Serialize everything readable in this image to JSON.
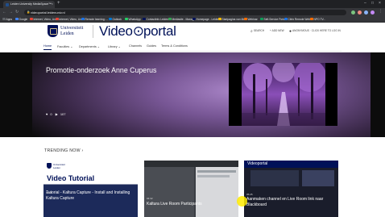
{
  "browser": {
    "tab_title": "Leiden University MediaSpace™",
    "url": "videoportal.leidenuniv.nl",
    "bookmarks": [
      {
        "label": "Apps",
        "color": "#5f6368"
      },
      {
        "label": "Google",
        "color": "#4285f4"
      },
      {
        "label": "Internet, Video, Live...",
        "color": "#ea4335"
      },
      {
        "label": "Internet, Video, Live...",
        "color": "#ea4335"
      },
      {
        "label": "Remote learning: ...",
        "color": "#1a73e8"
      },
      {
        "label": "Outlook",
        "color": "#0078d4"
      },
      {
        "label": "WhatsApp",
        "color": "#25d366"
      },
      {
        "label": "Contactinfo Leiden...",
        "color": "#001158"
      },
      {
        "label": "Mediasite - Manag...",
        "color": "#34a853"
      },
      {
        "label": "Homepage - Leiden...",
        "color": "#001158"
      },
      {
        "label": "Startpagina van Me...",
        "color": "#fbbc04"
      },
      {
        "label": "Webinar",
        "color": "#ff6d00"
      },
      {
        "label": "Self-Service Portal",
        "color": "#0f9d58"
      },
      {
        "label": "Citrix Remote Web...",
        "color": "#1a73e8"
      },
      {
        "label": "NPO TV...",
        "color": "#ff6d00"
      }
    ]
  },
  "header": {
    "logo_line1": "Universiteit",
    "logo_line2": "Leiden",
    "brand_part1": "Video",
    "brand_part2": "portal",
    "search_label": "SEARCH",
    "add_new_label": "+ ADD NEW",
    "user_label": "ANONYMOUS · CLICK HERE TO LOG IN"
  },
  "nav": {
    "items": [
      "Home",
      "Faculties ⌄",
      "Departments ⌄",
      "Library ⌄",
      "Channels",
      "Guides",
      "Terms & Conditions"
    ]
  },
  "hero": {
    "title": "Promotie-onderzoek Anne Cuperus",
    "likes": "0",
    "plays": "107"
  },
  "trending": {
    "heading": "TRENDING NOW ›",
    "cards": [
      {
        "banner": "Video Tutorial",
        "meta": "09:57",
        "title": "Tutorial - Kaltura Capture - Install and Installing Kaltura Capture"
      },
      {
        "banner": "",
        "meta": "04:32",
        "title": "Kaltura Live Room Participants"
      },
      {
        "banner": "Videoportal",
        "meta": "05:25",
        "title": "Aanmaken channel en Live Room link naar Blackboard"
      }
    ]
  }
}
